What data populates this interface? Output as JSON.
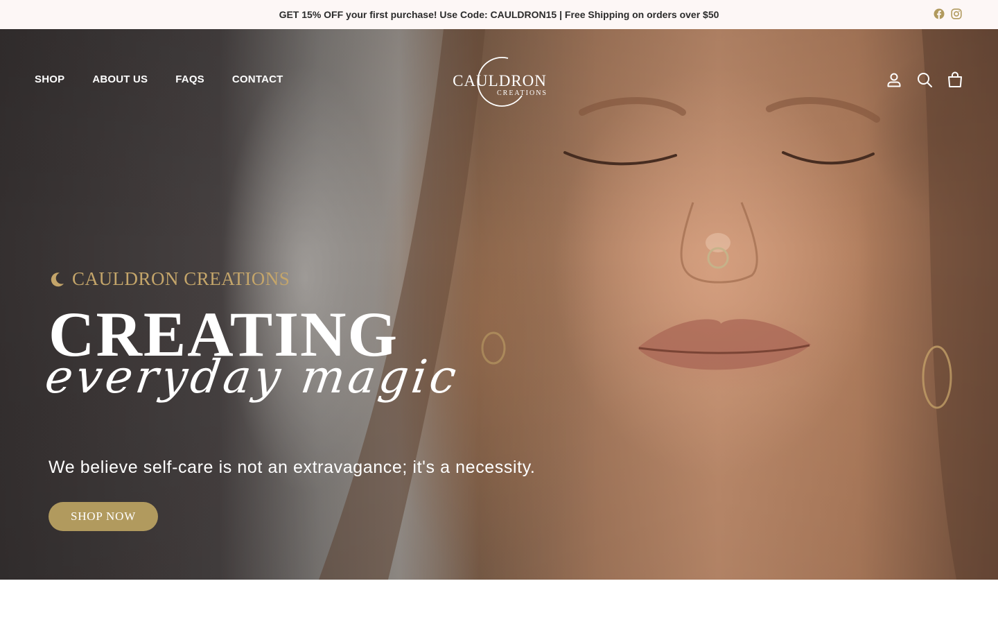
{
  "announcement": {
    "text": "GET 15% OFF your first purchase! Use Code: CAULDRON15 | Free Shipping on orders over $50",
    "socials": [
      "facebook-icon",
      "instagram-icon"
    ]
  },
  "nav": {
    "items": [
      {
        "label": "SHOP"
      },
      {
        "label": "ABOUT US"
      },
      {
        "label": "FAQS"
      },
      {
        "label": "CONTACT"
      }
    ]
  },
  "logo": {
    "name": "CAULDRON",
    "sub": "CREATIONS"
  },
  "utilities": [
    "account-icon",
    "search-icon",
    "cart-icon"
  ],
  "hero": {
    "eyebrow": "CAULDRON CREATIONS",
    "title": "CREATING",
    "script": "everyday magic",
    "lede": "We believe self-care is not an extravagance; it's a necessity.",
    "cta": "SHOP NOW"
  },
  "colors": {
    "accent_gold": "#b19a5e",
    "eyebrow_gold": "#c4a56a",
    "announcement_bg": "#fdf7f6"
  }
}
